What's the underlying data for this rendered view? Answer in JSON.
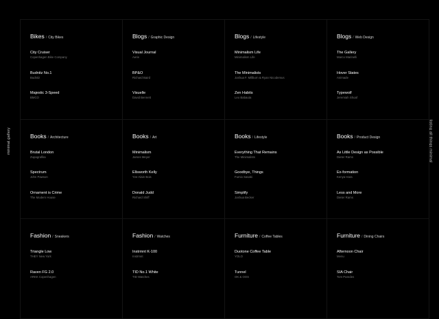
{
  "side_left": "minimal.gallery",
  "side_right": "listing all things minimal",
  "cards": [
    {
      "category": "Bikes",
      "sep": "/",
      "sub": "City Bikes",
      "items": [
        {
          "name": "City Cruiser",
          "by": "Copenhagen Bike Company"
        },
        {
          "name": "Budnitz No.1",
          "by": "Budnitz"
        },
        {
          "name": "Majestic 3-Speed",
          "by": "BMCO"
        }
      ]
    },
    {
      "category": "Blogs",
      "sep": "/",
      "sub": "Graphic Design",
      "items": [
        {
          "name": "Visual Journal",
          "by": "Aerie"
        },
        {
          "name": "BP&O",
          "by": "Richard Baird"
        },
        {
          "name": "Visuelle",
          "by": "David Bennett"
        }
      ]
    },
    {
      "category": "Blogs",
      "sep": "/",
      "sub": "Lifestyle",
      "items": [
        {
          "name": "Minimalism Life",
          "by": "Minimalism Life"
        },
        {
          "name": "The Minimalists",
          "by": "Joshua F. Millburn & Ryan Nicodemus"
        },
        {
          "name": "Zen Habits",
          "by": "Leo Babauta"
        }
      ]
    },
    {
      "category": "Blogs",
      "sep": "/",
      "sub": "Web Design",
      "items": [
        {
          "name": "The Gallery",
          "by": "Marco Marinelli"
        },
        {
          "name": "Hover States",
          "by": "Animade"
        },
        {
          "name": "Typewolf",
          "by": "Jeremiah Shoaf"
        }
      ]
    },
    {
      "category": "Books",
      "sep": "/",
      "sub": "Architecture",
      "items": [
        {
          "name": "Brutal London",
          "by": "Zupagrafika"
        },
        {
          "name": "Spectrum",
          "by": "John Pawson"
        },
        {
          "name": "Ornament is Crime",
          "by": "The Modern House"
        }
      ]
    },
    {
      "category": "Books",
      "sep": "/",
      "sub": "Art",
      "items": [
        {
          "name": "Minimalism",
          "by": "James Meyer"
        },
        {
          "name": "Ellsworth Kelly",
          "by": "Yve-Alain Bois"
        },
        {
          "name": "Donald Judd",
          "by": "Richard Shiff"
        }
      ]
    },
    {
      "category": "Books",
      "sep": "/",
      "sub": "Lifestyle",
      "items": [
        {
          "name": "Everything That Remains",
          "by": "The Minimalists"
        },
        {
          "name": "Goodbye, Things",
          "by": "Fumio Sasaki"
        },
        {
          "name": "Simplify",
          "by": "Joshua Becker"
        }
      ]
    },
    {
      "category": "Books",
      "sep": "/",
      "sub": "Product Design",
      "items": [
        {
          "name": "As Little Design as Possible",
          "by": "Dieter Rams"
        },
        {
          "name": "Ex-formation",
          "by": "Kenya Hara"
        },
        {
          "name": "Less and More",
          "by": "Dieter Rams"
        }
      ]
    },
    {
      "category": "Fashion",
      "sep": "/",
      "sub": "Sneakers",
      "items": [
        {
          "name": "Triangle Low",
          "by": "THEY New York"
        },
        {
          "name": "Raven FG 2.0",
          "by": "ARKK Copenhagen"
        }
      ]
    },
    {
      "category": "Fashion",
      "sep": "/",
      "sub": "Watches",
      "items": [
        {
          "name": "Instrmnt K-100",
          "by": "Instrmnt"
        },
        {
          "name": "TID No.1 White",
          "by": "TID Watches"
        }
      ]
    },
    {
      "category": "Furniture",
      "sep": "/",
      "sub": "Coffee Tables",
      "items": [
        {
          "name": "Duotone Coffee Table",
          "by": "YOLO"
        },
        {
          "name": "Tunnel",
          "by": "OK & OOS"
        }
      ]
    },
    {
      "category": "Furniture",
      "sep": "/",
      "sub": "Dining Chairs",
      "items": [
        {
          "name": "Afternoon Chair",
          "by": "Menu"
        },
        {
          "name": "SIA Chair",
          "by": "Tom Paredes"
        }
      ]
    }
  ]
}
